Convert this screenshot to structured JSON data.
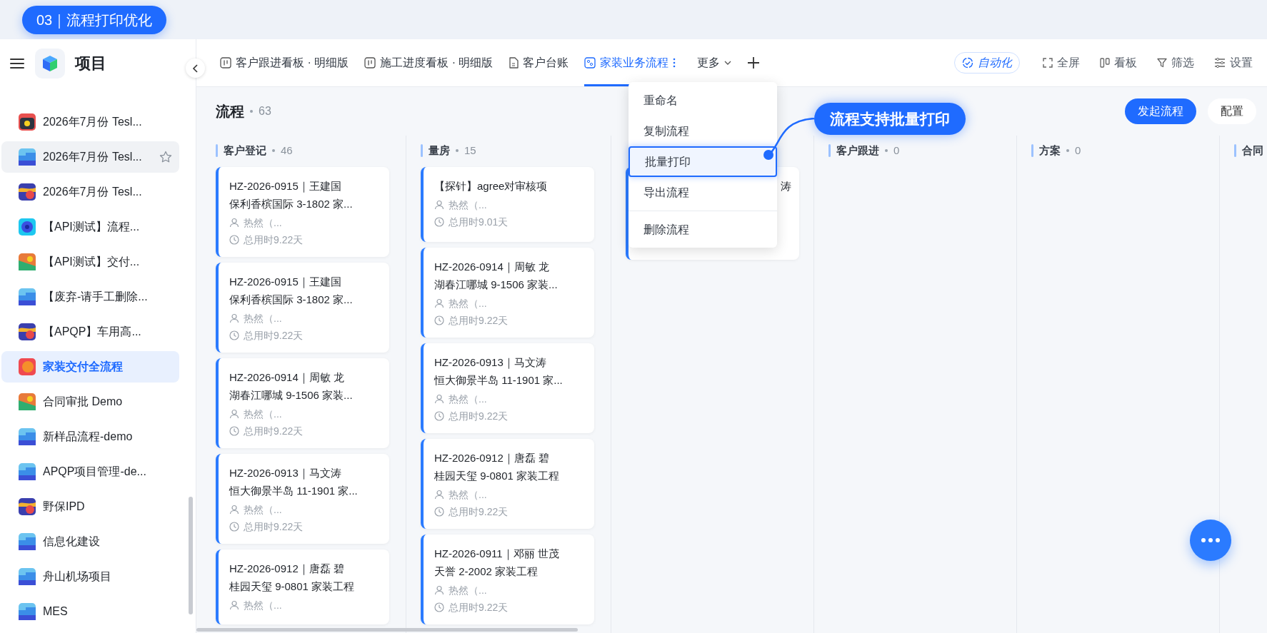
{
  "banner": {
    "label": "03｜流程打印优化"
  },
  "sidebar": {
    "title": "项目",
    "items": [
      {
        "label": "2026年7月份 Tesl...",
        "kind": "camera",
        "selected": false,
        "hovered": false
      },
      {
        "label": "2026年7月份 Tesl...",
        "kind": "layers",
        "selected": false,
        "hovered": true
      },
      {
        "label": "2026年7月份 Tesl...",
        "kind": "sunset",
        "selected": false,
        "hovered": false
      },
      {
        "label": "【API测试】流程...",
        "kind": "target",
        "selected": false,
        "hovered": false
      },
      {
        "label": "【API测试】交付...",
        "kind": "landscape",
        "selected": false,
        "hovered": false
      },
      {
        "label": "【废弃-请手工删除...",
        "kind": "layers",
        "selected": false,
        "hovered": false
      },
      {
        "label": "【APQP】车用高...",
        "kind": "sunset",
        "selected": false,
        "hovered": false
      },
      {
        "label": "家装交付全流程",
        "kind": "sun",
        "selected": true,
        "hovered": false
      },
      {
        "label": "合同审批 Demo",
        "kind": "landscape",
        "selected": false,
        "hovered": false
      },
      {
        "label": "新样品流程-demo",
        "kind": "layers",
        "selected": false,
        "hovered": false
      },
      {
        "label": "APQP项目管理-de...",
        "kind": "layers",
        "selected": false,
        "hovered": false
      },
      {
        "label": "野保IPD",
        "kind": "sunset",
        "selected": false,
        "hovered": false
      },
      {
        "label": "信息化建设",
        "kind": "layers",
        "selected": false,
        "hovered": false
      },
      {
        "label": "舟山机场项目",
        "kind": "layers",
        "selected": false,
        "hovered": false
      },
      {
        "label": "MES",
        "kind": "layers",
        "selected": false,
        "hovered": false
      }
    ]
  },
  "tabs": [
    {
      "label": "客户跟进看板 · 明细版",
      "kind": "board",
      "selected": false
    },
    {
      "label": "施工进度看板 · 明细版",
      "kind": "board",
      "selected": false
    },
    {
      "label": "客户台账",
      "kind": "doc",
      "selected": false
    },
    {
      "label": "家装业务流程",
      "kind": "flow",
      "selected": true
    }
  ],
  "more_tab": {
    "label": "更多"
  },
  "toolbar": [
    {
      "label": "自动化",
      "kind": "automation"
    },
    {
      "label": "全屏",
      "kind": "fullscreen"
    },
    {
      "label": "看板",
      "kind": "columns"
    },
    {
      "label": "筛选",
      "kind": "filter"
    },
    {
      "label": "设置",
      "kind": "sliders"
    }
  ],
  "board": {
    "title": "流程",
    "count": "63",
    "buttons": [
      {
        "label": "发起流程",
        "primary": true
      },
      {
        "label": "配置",
        "primary": false
      }
    ],
    "columns": [
      {
        "name": "客户登记",
        "count": "46",
        "cards": [
          {
            "title_lines": [
              "HZ-2026-0915｜王建国",
              "保利香槟国际 3-1802 家..."
            ],
            "owner": "热然（...",
            "duration": "总用时9.22天"
          },
          {
            "title_lines": [
              "HZ-2026-0915｜王建国",
              "保利香槟国际 3-1802 家..."
            ],
            "owner": "热然（...",
            "duration": "总用时9.22天"
          },
          {
            "title_lines": [
              "HZ-2026-0914｜周敏 龙",
              "湖春江哪城 9-1506 家装..."
            ],
            "owner": "热然（...",
            "duration": "总用时9.22天"
          },
          {
            "title_lines": [
              "HZ-2026-0913｜马文涛",
              "恒大御景半岛 11-1901 家..."
            ],
            "owner": "热然（...",
            "duration": "总用时9.22天"
          },
          {
            "title_lines": [
              "HZ-2026-0912｜唐磊 碧",
              "桂园天玺 9-0801 家装工程"
            ],
            "owner": "热然（..."
          }
        ]
      },
      {
        "name": "量房",
        "count": "15",
        "cards": [
          {
            "title_lines": [
              "【探针】agree对审核项"
            ],
            "owner": "热然（...",
            "duration": "总用时9.01天"
          },
          {
            "title_lines": [
              "HZ-2026-0914｜周敏 龙",
              "湖春江哪城 9-1506 家装..."
            ],
            "owner": "热然（...",
            "duration": "总用时9.22天"
          },
          {
            "title_lines": [
              "HZ-2026-0913｜马文涛",
              "恒大御景半岛 11-1901 家..."
            ],
            "owner": "热然（...",
            "duration": "总用时9.22天"
          },
          {
            "title_lines": [
              "HZ-2026-0912｜唐磊 碧",
              "桂园天玺 9-0801 家装工程"
            ],
            "owner": "热然（...",
            "duration": "总用时9.22天"
          },
          {
            "title_lines": [
              "HZ-2026-0911｜邓丽 世茂",
              "天誉 2-2002 家装工程"
            ],
            "owner": "热然（...",
            "duration": "总用时9.22天"
          }
        ]
      },
      {
        "cards": [
          {
            "title_lines": [
              "涛"
            ]
          }
        ]
      },
      {
        "name": "客户跟进",
        "count": "0"
      },
      {
        "name": "方案",
        "count": "0"
      },
      {
        "name": "合同"
      }
    ]
  },
  "context_menu": {
    "items": [
      {
        "label": "重命名",
        "selected": false,
        "separated": false
      },
      {
        "label": "复制流程",
        "selected": false,
        "separated": false
      },
      {
        "label": "批量打印",
        "selected": true,
        "separated": false
      },
      {
        "label": "导出流程",
        "selected": false,
        "separated": false
      },
      {
        "label": "删除流程",
        "selected": false,
        "separated": true
      }
    ]
  },
  "callout": {
    "text": "流程支持批量打印"
  }
}
